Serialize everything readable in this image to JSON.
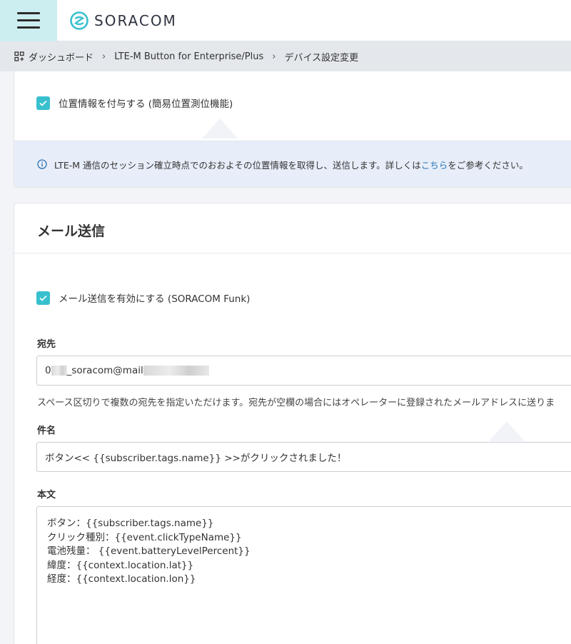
{
  "header": {
    "logo_text": "SORACOM"
  },
  "breadcrumb": {
    "items": [
      "ダッシュボード",
      "LTE-M Button for Enterprise/Plus",
      "デバイス設定変更"
    ]
  },
  "location_section": {
    "checkbox_label": "位置情報を付与する (簡易位置測位機能)",
    "info_text_before": "LTE-M 通信のセッション確立時点でのおおよその位置情報を取得し、送信します。詳しくは",
    "info_link": "こちら",
    "info_text_after": "をご参考ください。"
  },
  "mail_section": {
    "title": "メール送信",
    "enable_label": "メール送信を有効にする (SORACOM Funk)",
    "to_label": "宛先",
    "to_value_prefix": "0",
    "to_value_mid": "_soracom@mail",
    "to_help": "スペース区切りで複数の宛先を指定いただけます。宛先が空欄の場合にはオペレーターに登録されたメールアドレスに送りま",
    "subject_label": "件名",
    "subject_value": "ボタン<< {{subscriber.tags.name}} >>がクリックされました！",
    "body_label": "本文",
    "body_lines": [
      "ボタン：{{subscriber.tags.name}}",
      "クリック種別：{{event.clickTypeName}}",
      "電池残量： {{event.batteryLevelPercent}}",
      "緯度：{{context.location.lat}}",
      "経度：{{context.location.lon}}"
    ]
  },
  "colors": {
    "accent": "#39c0ce",
    "menu_bg": "#cdeef0",
    "info_bg": "#e8eef9",
    "link": "#2a78b8"
  }
}
